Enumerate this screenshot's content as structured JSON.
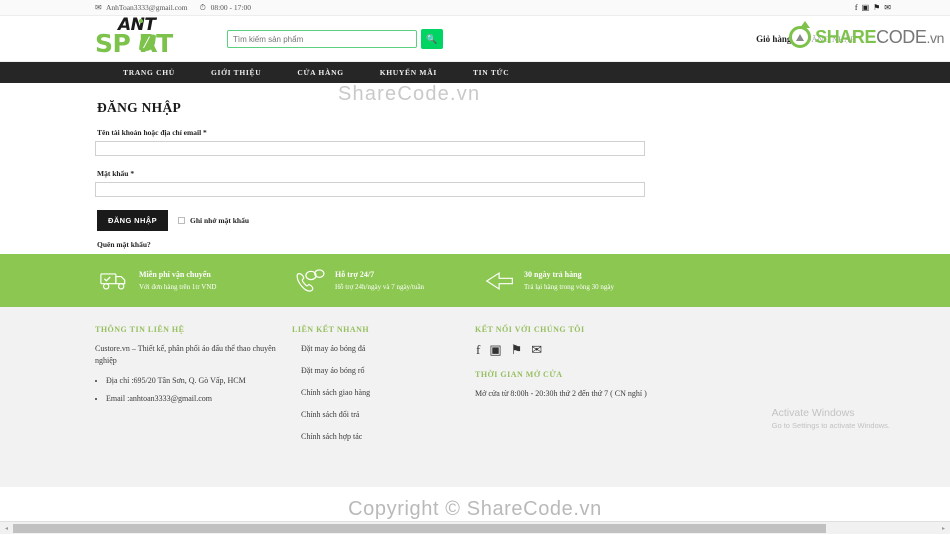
{
  "topbar": {
    "email": "AnhToan3333@gmail.com",
    "hours": "08:00 - 17:00",
    "email_icon": "envelope-icon",
    "clock_icon": "clock-icon",
    "social": [
      {
        "name": "facebook-icon",
        "glyph": "f"
      },
      {
        "name": "instagram-icon",
        "glyph": "▣"
      },
      {
        "name": "twitter-icon",
        "glyph": "⚑"
      },
      {
        "name": "email-icon",
        "glyph": "✉"
      }
    ]
  },
  "header": {
    "logo_top": "ANT",
    "logo_bottom": "SP RT",
    "search_placeholder": "Tìm kiếm sản phẩm",
    "search_value": "",
    "search_icon": "search-icon",
    "cart_label": "Giỏ hàng",
    "login_label": "ĐĂNG NHẬP",
    "watermark_share": "SHARE",
    "watermark_code": "CODE",
    "watermark_vn": ".vn"
  },
  "nav": {
    "items": [
      {
        "label": "TRANG CHỦ"
      },
      {
        "label": "GIỚI THIỆU"
      },
      {
        "label": "CỬA HÀNG"
      },
      {
        "label": "KHUYẾN MÃI"
      },
      {
        "label": "TIN TỨC"
      }
    ]
  },
  "main": {
    "title": "ĐĂNG NHẬP",
    "watermark": "ShareCode.vn",
    "username_label": "Tên tài khoản hoặc địa chỉ email *",
    "username_value": "",
    "password_label": "Mật khẩu *",
    "password_value": "",
    "submit_label": "ĐĂNG NHẬP",
    "remember_label": "Ghi nhớ mật khẩu",
    "forgot_label": "Quên mật khẩu?"
  },
  "features": [
    {
      "icon": "truck-icon",
      "title": "Miễn phí vận chuyển",
      "subtitle": "Với đơn hàng trên 1tr VND"
    },
    {
      "icon": "support-phone-icon",
      "title": "Hỗ trợ 24/7",
      "subtitle": "Hỗ trợ 24h/ngày và 7 ngày/tuần"
    },
    {
      "icon": "return-arrow-icon",
      "title": "30 ngày trả hàng",
      "subtitle": "Trả lại hàng trong vòng 30 ngày"
    }
  ],
  "footer": {
    "contact": {
      "heading": "THÔNG TIN LIÊN HỆ",
      "description": "Custore.vn – Thiết kế, phân phối áo đấu thể thao chuyên nghiệp",
      "items": [
        "Địa chỉ :695/20 Tân Sơn, Q. Gò Vấp, HCM",
        "Email :anhtoan3333@gmail.com"
      ]
    },
    "quicklinks": {
      "heading": "LIÊN KẾT NHANH",
      "items": [
        "Đặt may áo bóng đá",
        "Đặt may áo bóng rổ",
        "Chính sách giao hàng",
        "Chính sách đổi trả",
        "Chính sách hợp tác"
      ]
    },
    "connect": {
      "heading": "KẾT NỐI VỚI CHÚNG TÔI",
      "social": [
        {
          "name": "facebook-icon",
          "glyph": "f"
        },
        {
          "name": "instagram-icon",
          "glyph": "▣"
        },
        {
          "name": "twitter-icon",
          "glyph": "⚑"
        },
        {
          "name": "email-icon",
          "glyph": "✉"
        }
      ],
      "hours_heading": "THỜI GIAN MỞ CỬA",
      "hours_text": "Mở cửa từ 8:00h - 20:30h thứ 2 đến thứ 7 ( CN nghỉ )"
    }
  },
  "watermark_overlay": {
    "activate_title": "Activate Windows",
    "activate_subtitle": "Go to Settings to activate Windows."
  },
  "copyright": {
    "text": "Copyright © ShareCode.vn"
  },
  "scrollbar": {
    "left_arrow": "◂",
    "right_arrow": "▸"
  },
  "colors": {
    "brand_green": "#7cc24b",
    "feature_bar": "#8cc751",
    "search_button": "#00d564",
    "nav_dark": "#262626",
    "footer_bg": "#f2f2f2",
    "heading_green": "#96bf5f"
  }
}
